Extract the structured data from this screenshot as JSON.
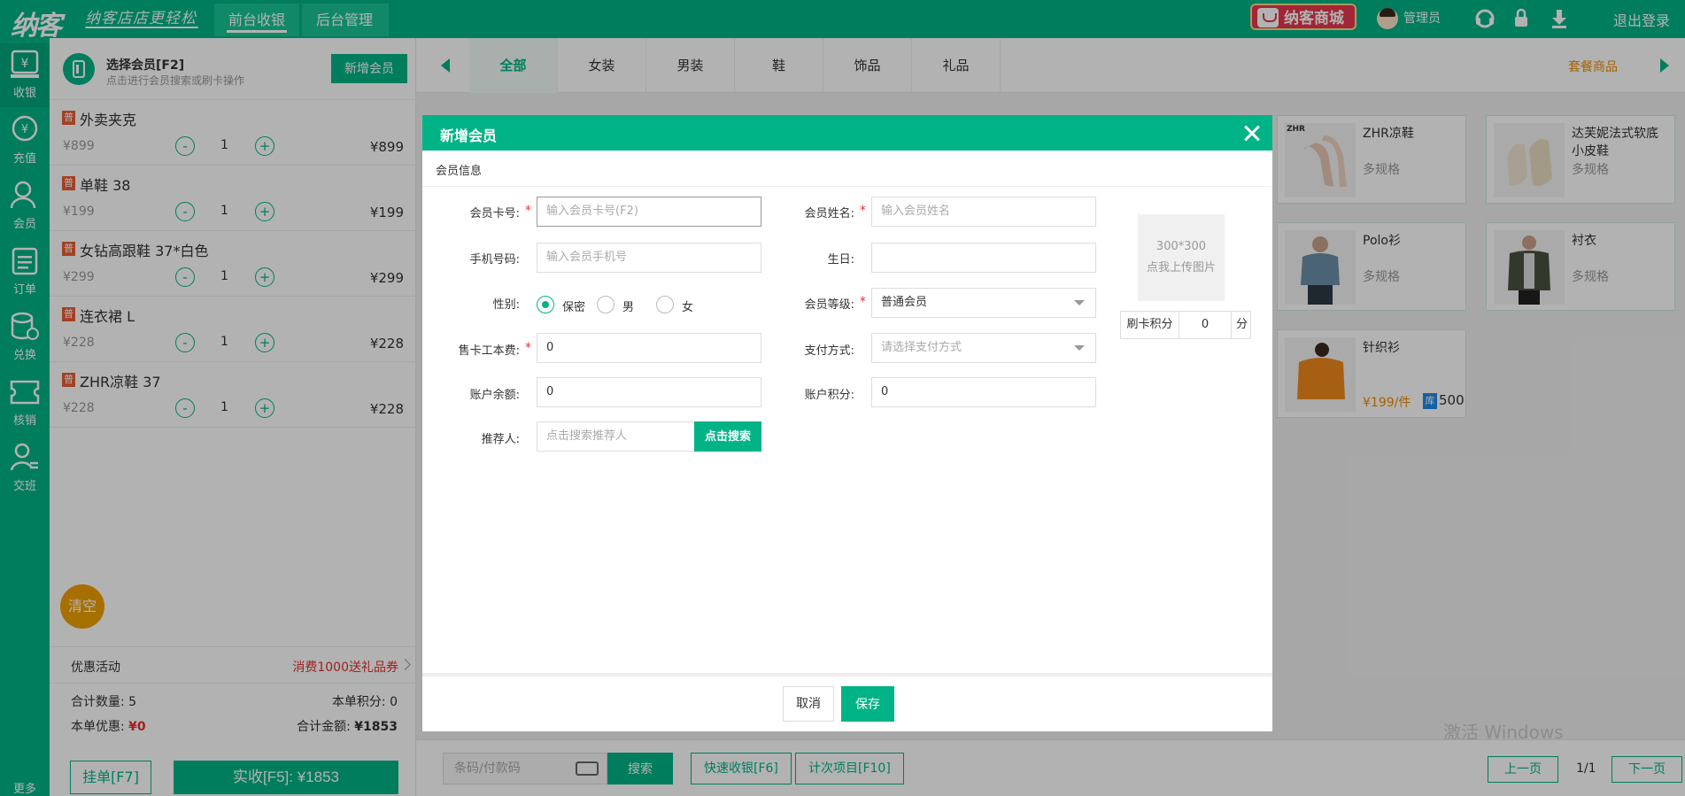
{
  "header": {
    "logo": "纳客",
    "slogan": "纳客店店更轻松",
    "tabs": [
      {
        "label": "前台收银"
      },
      {
        "label": "后台管理"
      }
    ],
    "mall": "纳客商城",
    "user": "管理员",
    "logout": "退出登录"
  },
  "sidebar": {
    "items": [
      {
        "label": "收银"
      },
      {
        "label": "充值"
      },
      {
        "label": "会员"
      },
      {
        "label": "订单"
      },
      {
        "label": "兑换"
      },
      {
        "label": "核销"
      },
      {
        "label": "交班"
      }
    ],
    "more": "更多"
  },
  "cart": {
    "member_title": "选择会员[F2]",
    "member_sub": "点击进行会员搜索或刷卡操作",
    "new_member": "新增会员",
    "badge": "普",
    "items": [
      {
        "name": "外卖夹克",
        "price": "¥899",
        "qty": "1",
        "total": "¥899"
      },
      {
        "name": "单鞋 38",
        "price": "¥199",
        "qty": "1",
        "total": "¥199"
      },
      {
        "name": "女钻高跟鞋 37*白色",
        "price": "¥299",
        "qty": "1",
        "total": "¥299"
      },
      {
        "name": "连衣裙 L",
        "price": "¥228",
        "qty": "1",
        "total": "¥228"
      },
      {
        "name": "ZHR凉鞋 37",
        "price": "¥228",
        "qty": "1",
        "total": "¥228"
      }
    ],
    "minus": "-",
    "plus": "+",
    "clear": "清空",
    "promo_label": "优惠活动",
    "promo_value": "消费1000送礼品券",
    "count_label": "合计数量:",
    "count_value": "5",
    "points_label": "本单积分:",
    "points_value": "0",
    "discount_label": "本单优惠:",
    "discount_value": "¥0",
    "amount_label": "合计金额:",
    "amount_value": "¥1853",
    "hang_btn": "挂单[F7]",
    "pay_btn": "实收[F5]: ¥1853"
  },
  "products": {
    "categories": [
      {
        "label": "全部"
      },
      {
        "label": "女装"
      },
      {
        "label": "男装"
      },
      {
        "label": "鞋"
      },
      {
        "label": "饰品"
      },
      {
        "label": "礼品"
      }
    ],
    "combo": "套餐商品",
    "cards": [
      {
        "name": "ZHR凉鞋",
        "spec": "多规格",
        "img_tag": "ZHR"
      },
      {
        "name": "达芙妮法式软底小皮鞋",
        "spec": "多规格"
      },
      {
        "name": "Polo衫",
        "spec": "多规格"
      },
      {
        "name": "衬衣",
        "spec": "多规格"
      },
      {
        "name": "针织衫",
        "price": "¥199/件",
        "stock_badge": "库",
        "stock": "500"
      }
    ],
    "scan_placeholder": "条码/付款码",
    "search_btn": "搜索",
    "quick_btn": "快速收银[F6]",
    "count_btn": "计次项目[F10]",
    "prev": "上一页",
    "page": "1/1",
    "next": "下一页",
    "watermark": "激活 Windows"
  },
  "modal": {
    "title": "新增会员",
    "section": "会员信息",
    "card_no_label": "会员卡号:",
    "card_no_placeholder": "输入会员卡号(F2)",
    "name_label": "会员姓名:",
    "name_placeholder": "输入会员姓名",
    "phone_label": "手机号码:",
    "phone_placeholder": "输入会员手机号",
    "birthday_label": "生日:",
    "gender_label": "性别:",
    "gender_options": [
      {
        "label": "保密",
        "checked": true
      },
      {
        "label": "男"
      },
      {
        "label": "女"
      }
    ],
    "level_label": "会员等级:",
    "level_value": "普通会员",
    "card_fee_label": "售卡工本费:",
    "card_fee_value": "0",
    "pay_label": "支付方式:",
    "pay_placeholder": "请选择支付方式",
    "balance_label": "账户余额:",
    "balance_value": "0",
    "acct_points_label": "账户积分:",
    "acct_points_value": "0",
    "referrer_label": "推荐人:",
    "referrer_placeholder": "点击搜索推荐人",
    "referrer_btn": "点击搜索",
    "upload_size": "300*300",
    "upload_hint": "点我上传图片",
    "swipe_points_label": "刷卡积分",
    "swipe_points_value": "0",
    "swipe_points_unit": "分",
    "required_mark": "*",
    "cancel": "取消",
    "save": "保存"
  },
  "colors": {
    "brand": "#00b386",
    "danger": "#e62e2e",
    "warning": "#f08c00"
  },
  "icons": [
    "cashier-icon",
    "recharge-icon",
    "member-icon",
    "order-icon",
    "exchange-icon",
    "verify-icon",
    "shift-icon",
    "headset-icon",
    "lock-icon",
    "download-icon",
    "close-icon"
  ]
}
